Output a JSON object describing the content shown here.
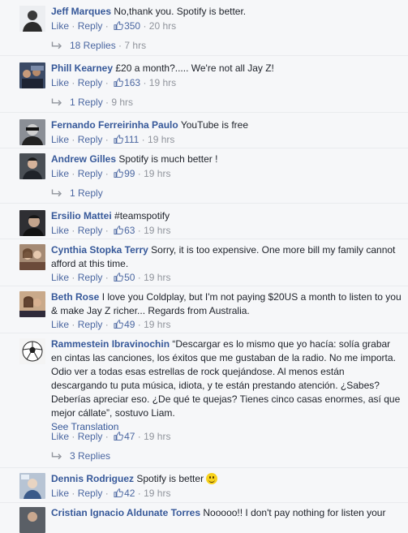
{
  "labels": {
    "like": "Like",
    "reply": "Reply",
    "dot": "·",
    "see_translation": "See Translation"
  },
  "comments": [
    {
      "name": "Jeff Marques",
      "text": "No,thank you. Spotify is better.",
      "likes": "350",
      "time": "20 hrs",
      "replies": "18 Replies",
      "replies_time": "7 hrs"
    },
    {
      "name": "Phill Kearney",
      "text": "£20 a month?..... We're not all Jay Z!",
      "likes": "163",
      "time": "19 hrs",
      "replies": "1 Reply",
      "replies_time": "9 hrs"
    },
    {
      "name": "Fernando Ferreirinha Paulo",
      "text": "YouTube is free",
      "likes": "111",
      "time": "19 hrs"
    },
    {
      "name": "Andrew Gilles",
      "text": "Spotify is much better !",
      "likes": "99",
      "time": "19 hrs",
      "replies": "1 Reply"
    },
    {
      "name": "Ersilio Mattei",
      "text": "#teamspotify",
      "likes": "63",
      "time": "19 hrs"
    },
    {
      "name": "Cynthia Stopka Terry",
      "text": "Sorry, it is too expensive. One more bill my family cannot afford at this time.",
      "likes": "50",
      "time": "19 hrs"
    },
    {
      "name": "Beth Rose",
      "text": "I love you Coldplay, but I'm not paying $20US a month to listen to you & make Jay Z richer... Regards from Australia.",
      "likes": "49",
      "time": "19 hrs"
    },
    {
      "name": "Rammestein Ibravinochin",
      "text": "“Descargar es lo mismo que yo hacía: solía grabar en cintas las canciones, los éxitos que me gustaban de la radio. No me importa. Odio ver a todas esas estrellas de rock quejándose. Al menos están descargando tu puta música, idiota, y te están prestando atención. ¿Sabes? Deberías apreciar eso. ¿De qué te quejas? Tienes cinco casas enormes, así que mejor cállate”, sostuvo Liam.",
      "likes": "47",
      "time": "19 hrs",
      "replies": "3 Replies"
    },
    {
      "name": "Dennis Rodriguez",
      "text": "Spotify is better",
      "likes": "42",
      "time": "19 hrs"
    },
    {
      "name": "Cristian Ignacio Aldunate Torres",
      "text": "Nooooo!! I don't pay nothing for listen your"
    }
  ]
}
